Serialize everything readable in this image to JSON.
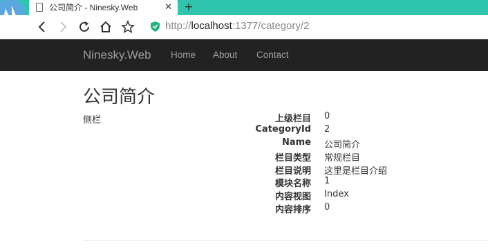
{
  "browser": {
    "tab_title": "公司简介 - Ninesky.Web",
    "tab_close": "✕",
    "new_tab": "+",
    "url_scheme": "http://",
    "url_host": "localhost",
    "url_rest": ":1377/category/2"
  },
  "navbar": {
    "brand": "Ninesky.Web",
    "links": [
      "Home",
      "About",
      "Contact"
    ]
  },
  "page": {
    "title": "公司简介",
    "sidebar": "侧栏",
    "details": [
      {
        "label": "上级栏目",
        "value": "0"
      },
      {
        "label": "CategoryId",
        "value": "2"
      },
      {
        "label": "Name",
        "value": "公司简介"
      },
      {
        "label": "栏目类型",
        "value": "常规栏目"
      },
      {
        "label": "栏目说明",
        "value": "这里是栏目介绍"
      },
      {
        "label": "模块名称",
        "value": "1"
      },
      {
        "label": "内容视图",
        "value": "Index"
      },
      {
        "label": "内容排序",
        "value": "0"
      }
    ]
  },
  "colors": {
    "tabstrip": "#2fc4ad",
    "navbar": "#222222",
    "navbar_text": "#9d9d9d",
    "shield": "#27b17e"
  }
}
